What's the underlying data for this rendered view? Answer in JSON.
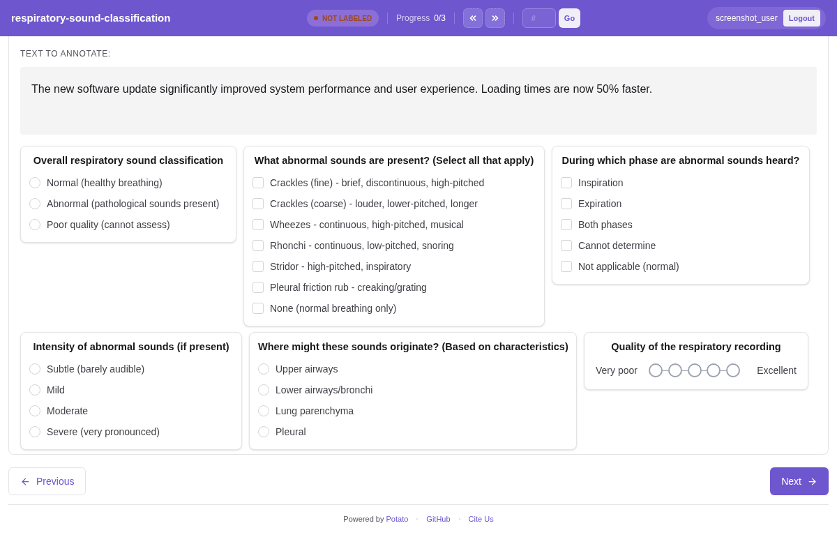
{
  "header": {
    "title": "respiratory-sound-classification",
    "status": {
      "label": "NOT LABELED",
      "labeled": false
    },
    "progress_label": "Progress",
    "progress_value": "0/3",
    "jump": {
      "placeholder": "#",
      "button": "Go"
    },
    "user": "screenshot_user",
    "logout": "Logout"
  },
  "text_section": {
    "heading": "TEXT TO ANNOTATE:",
    "text": "The new software update significantly improved system performance and user experience. Loading times are now 50% faster."
  },
  "questions": [
    {
      "kind": "radio",
      "title": "Overall respiratory sound classification",
      "options": [
        {
          "label": "Normal (healthy breathing)",
          "selected": false
        },
        {
          "label": "Abnormal (pathological sounds present)",
          "selected": false
        },
        {
          "label": "Poor quality (cannot assess)",
          "selected": false
        }
      ]
    },
    {
      "kind": "checkbox",
      "title": "What abnormal sounds are present? (Select all that apply)",
      "options": [
        {
          "label": "Crackles (fine) - brief, discontinuous, high-pitched",
          "checked": false
        },
        {
          "label": "Crackles (coarse) - louder, lower-pitched, longer",
          "checked": false
        },
        {
          "label": "Wheezes - continuous, high-pitched, musical",
          "checked": false
        },
        {
          "label": "Rhonchi - continuous, low-pitched, snoring",
          "checked": false
        },
        {
          "label": "Stridor - high-pitched, inspiratory",
          "checked": false
        },
        {
          "label": "Pleural friction rub - creaking/grating",
          "checked": false
        },
        {
          "label": "None (normal breathing only)",
          "checked": false
        }
      ]
    },
    {
      "kind": "checkbox",
      "title": "During which phase are abnormal sounds heard?",
      "options": [
        {
          "label": "Inspiration",
          "checked": false
        },
        {
          "label": "Expiration",
          "checked": false
        },
        {
          "label": "Both phases",
          "checked": false
        },
        {
          "label": "Cannot determine",
          "checked": false
        },
        {
          "label": "Not applicable (normal)",
          "checked": false
        }
      ]
    },
    {
      "kind": "radio",
      "title": "Intensity of abnormal sounds (if present)",
      "options": [
        {
          "label": "Subtle (barely audible)",
          "selected": false
        },
        {
          "label": "Mild",
          "selected": false
        },
        {
          "label": "Moderate",
          "selected": false
        },
        {
          "label": "Severe (very pronounced)",
          "selected": false
        }
      ]
    },
    {
      "kind": "radio",
      "title": "Where might these sounds originate? (Based on characteristics)",
      "options": [
        {
          "label": "Upper airways",
          "selected": false
        },
        {
          "label": "Lower airways/bronchi",
          "selected": false
        },
        {
          "label": "Lung parenchyma",
          "selected": false
        },
        {
          "label": "Pleural",
          "selected": false
        }
      ]
    },
    {
      "kind": "rating",
      "title": "Quality of the respiratory recording",
      "low": "Very poor",
      "high": "Excellent",
      "points": [
        {
          "selected": false
        },
        {
          "selected": false
        },
        {
          "selected": false
        },
        {
          "selected": false
        },
        {
          "selected": false
        }
      ]
    }
  ],
  "nav": {
    "previous": "Previous",
    "next": "Next"
  },
  "footer": {
    "powered_by": "Powered by",
    "potato": "Potato",
    "links": [
      "GitHub",
      "Cite Us"
    ]
  }
}
